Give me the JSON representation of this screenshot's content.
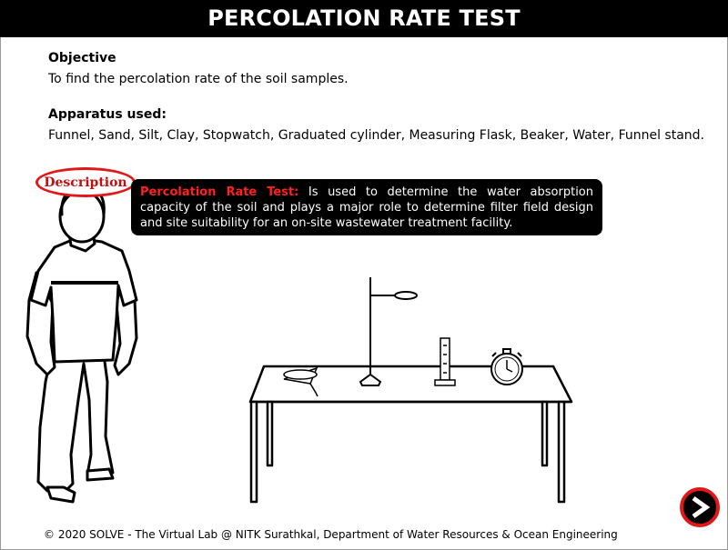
{
  "header": {
    "title": "PERCOLATION RATE TEST"
  },
  "objective": {
    "heading": "Objective",
    "text": "To find the percolation rate of the soil samples."
  },
  "apparatus": {
    "heading": "Apparatus used:",
    "text": "Funnel, Sand, Silt, Clay, Stopwatch, Graduated cylinder, Measuring Flask, Beaker, Water, Funnel stand."
  },
  "description_button": {
    "label": "Description"
  },
  "tooltip": {
    "term": "Percolation Rate Test:",
    "text": " Is used to determine the water absorption capacity of the soil and plays a major role to determine filter field design and site suitability for an on-site wastewater treatment facility."
  },
  "next_button": {
    "icon": "chevron-right-icon"
  },
  "footer": {
    "text": "© 2020 SOLVE - The Virtual Lab @ NITK Surathkal, Department of Water Resources & Ocean Engineering"
  },
  "colors": {
    "accent_red": "#e01818",
    "header_bg": "#000000",
    "tooltip_bg": "#000000"
  }
}
